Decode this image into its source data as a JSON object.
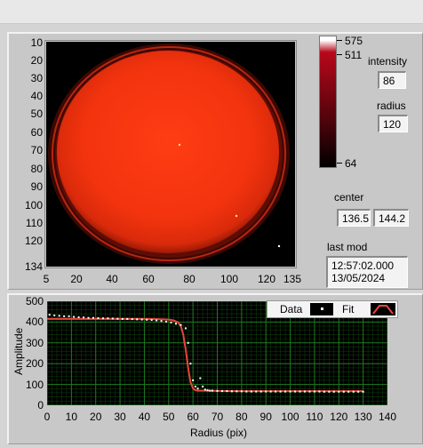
{
  "image_view": {
    "y_ticks": [
      "10",
      "20",
      "30",
      "40",
      "50",
      "60",
      "70",
      "80",
      "90",
      "100",
      "110",
      "120",
      "134"
    ],
    "x_ticks": [
      "5",
      "20",
      "40",
      "60",
      "80",
      "100",
      "120",
      "135"
    ],
    "colorbar_ticks": [
      "575",
      "511",
      "64"
    ]
  },
  "fields": {
    "intensity_label": "intensity",
    "intensity_value": "86",
    "radius_label": "radius",
    "radius_value": "120",
    "center_label": "center",
    "center_x": "136.5",
    "center_y": "144.2",
    "last_mod_label": "last mod",
    "last_mod_time": "12:57:02.000",
    "last_mod_date": "13/05/2024"
  },
  "colors": {
    "data_points": "#ffffff",
    "fit_line": "#e8463a",
    "plot_bg": "#000000",
    "grid": "#1f7a1f"
  },
  "chart_data": {
    "type": "scatter",
    "xlabel": "Radius (pix)",
    "ylabel": "Amplitude",
    "xlim": [
      0,
      140
    ],
    "ylim": [
      0,
      500
    ],
    "x_ticks": [
      0,
      10,
      20,
      30,
      40,
      50,
      60,
      70,
      80,
      90,
      100,
      110,
      120,
      130,
      140
    ],
    "y_ticks": [
      0,
      100,
      200,
      300,
      400,
      500
    ],
    "legend": [
      "Data",
      "Fit"
    ],
    "series": [
      {
        "name": "Data",
        "type": "scatter",
        "x": [
          1,
          3,
          5,
          7,
          9,
          11,
          13,
          15,
          17,
          19,
          21,
          23,
          25,
          27,
          29,
          31,
          33,
          35,
          37,
          39,
          41,
          43,
          45,
          47,
          49,
          51,
          53,
          55,
          57,
          58,
          59,
          60,
          61,
          62,
          63,
          64,
          65,
          66,
          67,
          68,
          70,
          72,
          74,
          76,
          78,
          80,
          82,
          84,
          86,
          88,
          90,
          92,
          94,
          96,
          98,
          100,
          102,
          104,
          106,
          108,
          110,
          112,
          114,
          116,
          118,
          120,
          122,
          124,
          126,
          128,
          130
        ],
        "y": [
          435,
          432,
          430,
          428,
          428,
          425,
          423,
          422,
          420,
          420,
          419,
          418,
          418,
          417,
          416,
          415,
          415,
          414,
          413,
          412,
          411,
          410,
          408,
          405,
          402,
          398,
          392,
          386,
          370,
          300,
          200,
          120,
          90,
          80,
          130,
          90,
          75,
          72,
          70,
          70,
          69,
          68,
          68,
          67,
          67,
          67,
          66,
          66,
          66,
          66,
          66,
          66,
          66,
          66,
          66,
          66,
          66,
          66,
          66,
          66,
          66,
          66,
          65,
          65,
          65,
          65,
          65,
          65,
          65,
          65,
          65
        ]
      },
      {
        "name": "Fit",
        "type": "line",
        "x": [
          0,
          10,
          20,
          30,
          40,
          45,
          50,
          52,
          54,
          55,
          56,
          57,
          58,
          59,
          60,
          61,
          62,
          63,
          65,
          70,
          80,
          90,
          100,
          110,
          120,
          130
        ],
        "y": [
          415,
          415,
          415,
          415,
          415,
          414,
          412,
          408,
          398,
          380,
          340,
          270,
          180,
          110,
          82,
          72,
          70,
          70,
          70,
          69,
          68,
          68,
          68,
          68,
          68,
          68
        ]
      }
    ]
  }
}
